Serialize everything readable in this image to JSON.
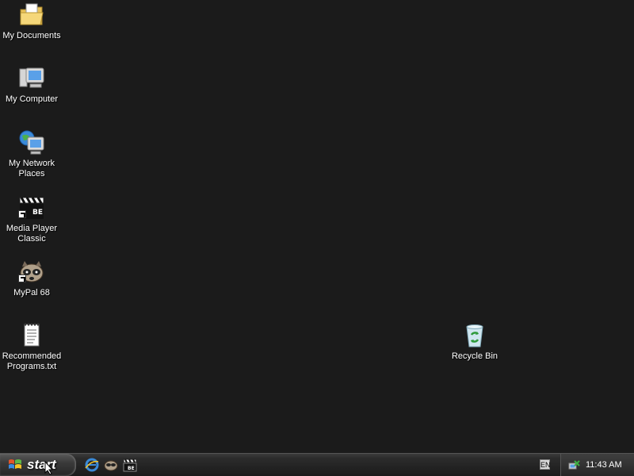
{
  "desktop": {
    "icons": [
      {
        "label": "My Documents",
        "icon": "folder-documents-icon"
      },
      {
        "label": "My Computer",
        "icon": "computer-icon"
      },
      {
        "label": "My Network\nPlaces",
        "icon": "network-places-icon"
      },
      {
        "label": "Media Player\nClassic",
        "icon": "media-player-classic-icon"
      },
      {
        "label": "MyPal 68",
        "icon": "mypal-icon"
      },
      {
        "label": "Recommended\nPrograms.txt",
        "icon": "text-file-icon"
      },
      {
        "label": "Recycle Bin",
        "icon": "recycle-bin-icon"
      }
    ]
  },
  "taskbar": {
    "start_label": "start",
    "quick_launch": [
      "internet-explorer-icon",
      "mypal-icon",
      "media-player-classic-icon"
    ],
    "language": "EN",
    "clock": "11:43 AM"
  },
  "colors": {
    "desktop_bg": "#1b1b1b",
    "label_text": "#ffffff"
  }
}
